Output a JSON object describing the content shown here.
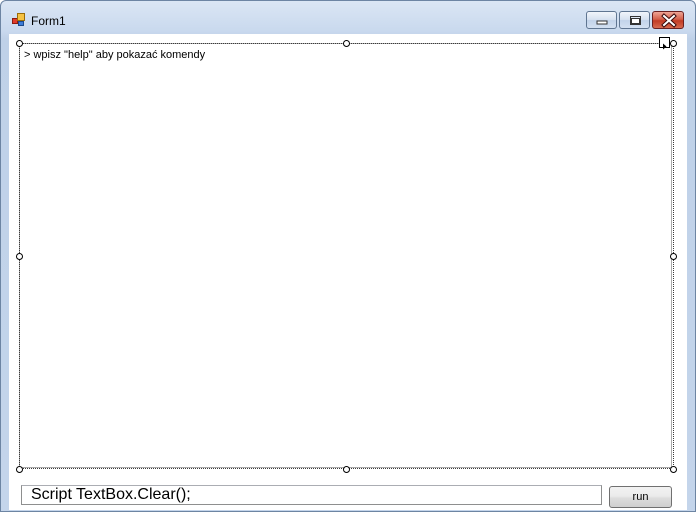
{
  "window": {
    "title": "Form1",
    "icon": "form-icon",
    "caption_buttons": [
      "minimize-icon",
      "maximize-icon",
      "close-icon"
    ]
  },
  "console": {
    "text": "> wpisz \"help\" aby pokazać komendy"
  },
  "script_input": {
    "value": "Script TextBox.Clear();"
  },
  "run_button": {
    "label": "run"
  },
  "colors": {
    "title_bar": "#c9d9ee",
    "close_button": "#c23b24"
  }
}
